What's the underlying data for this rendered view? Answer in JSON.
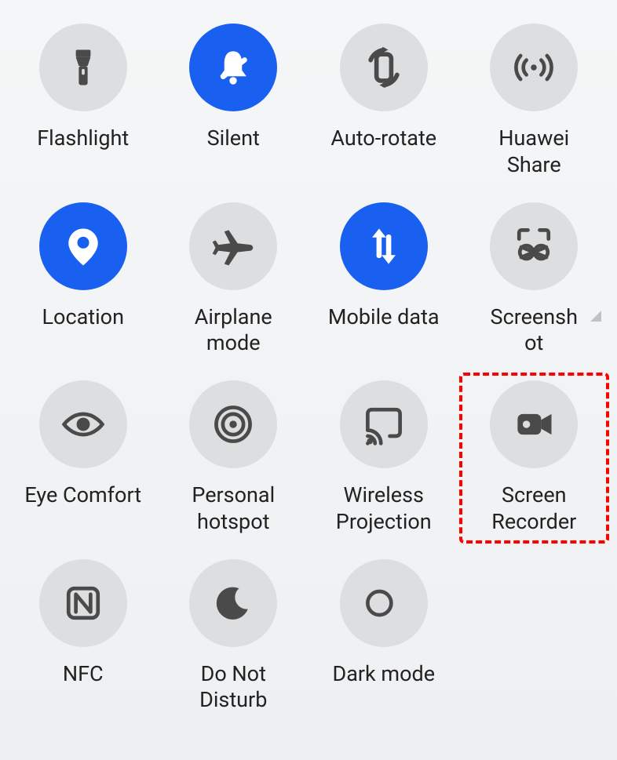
{
  "colors": {
    "active": "#1a60f0",
    "inactive": "#dcdee0",
    "highlight": "#ff0000"
  },
  "tiles": [
    {
      "key": "flashlight",
      "label": "Flashlight",
      "active": false,
      "icon": "flashlight-icon"
    },
    {
      "key": "silent",
      "label": "Silent",
      "active": true,
      "icon": "silent-icon"
    },
    {
      "key": "autorotate",
      "label": "Auto-rotate",
      "active": false,
      "icon": "rotate-icon"
    },
    {
      "key": "huaweishare",
      "label": "Huawei\nShare",
      "active": false,
      "icon": "broadcast-icon"
    },
    {
      "key": "location",
      "label": "Location",
      "active": true,
      "icon": "location-icon"
    },
    {
      "key": "airplane",
      "label": "Airplane\nmode",
      "active": false,
      "icon": "airplane-icon"
    },
    {
      "key": "mobiledata",
      "label": "Mobile data",
      "active": true,
      "icon": "data-icon"
    },
    {
      "key": "screenshot",
      "label": "Screensh\not",
      "active": false,
      "icon": "screenshot-icon",
      "expandable": true
    },
    {
      "key": "eyecomfort",
      "label": "Eye Comfort",
      "active": false,
      "icon": "eye-icon"
    },
    {
      "key": "hotspot",
      "label": "Personal\nhotspot",
      "active": false,
      "icon": "hotspot-icon"
    },
    {
      "key": "projection",
      "label": "Wireless\nProjection",
      "active": false,
      "icon": "cast-icon"
    },
    {
      "key": "screenrecorder",
      "label": "Screen\nRecorder",
      "active": false,
      "icon": "videocam-icon",
      "highlighted": true
    },
    {
      "key": "nfc",
      "label": "NFC",
      "active": false,
      "icon": "nfc-icon"
    },
    {
      "key": "dnd",
      "label": "Do Not\nDisturb",
      "active": false,
      "icon": "moon-icon"
    },
    {
      "key": "darkmode",
      "label": "Dark mode",
      "active": false,
      "icon": "contrast-icon"
    }
  ]
}
